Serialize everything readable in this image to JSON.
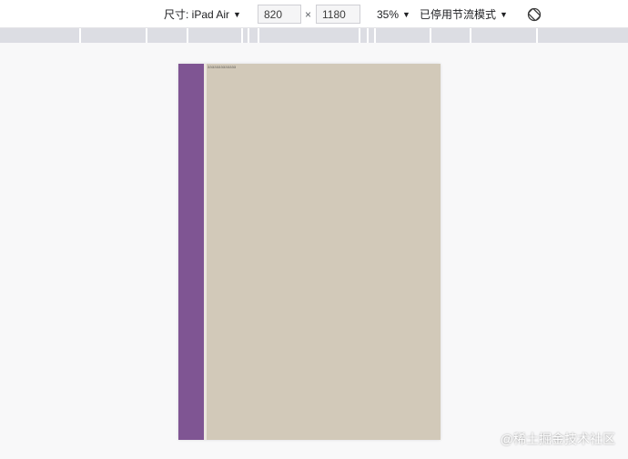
{
  "toolbar": {
    "size_label": "尺寸: iPad Air",
    "width_value": "820",
    "times_symbol": "×",
    "height_value": "1180",
    "zoom_label": "35%",
    "throttle_label": "已停用节流模式",
    "caret": "▼",
    "rotate_icon": "rotate-icon"
  },
  "device": {
    "text": "aaaaaaaaaaaaa",
    "colors": {
      "sidebar": "#7f5593",
      "content": "#d2c9b9"
    }
  },
  "watermark": "@稀土掘金技术社区"
}
